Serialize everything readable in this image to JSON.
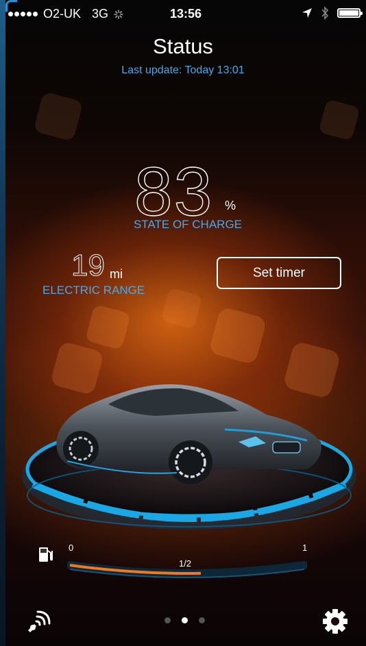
{
  "status_bar": {
    "carrier": "O2-UK",
    "network": "3G",
    "time": "13:56"
  },
  "header": {
    "title": "Status",
    "last_update": "Last update: Today 13:01"
  },
  "charge": {
    "value": "83",
    "unit": "%",
    "label": "STATE OF CHARGE"
  },
  "range": {
    "value": "19",
    "unit": "mi",
    "label": "ELECTRIC RANGE"
  },
  "timer_button": {
    "label": "Set timer"
  },
  "fuel_gauge": {
    "min_label": "0",
    "max_label": "1",
    "mid_label": "1/2",
    "level": 0.57
  },
  "pager": {
    "pages": 3,
    "active": 2
  },
  "colors": {
    "accent": "#4aa8e8",
    "ring": "#1aa7e6",
    "fuel": "#f07a1a"
  },
  "icons": {
    "bottom_left": "remote-signal-icon",
    "bottom_right": "gear-icon",
    "fuel": "fuel-pump-icon"
  }
}
